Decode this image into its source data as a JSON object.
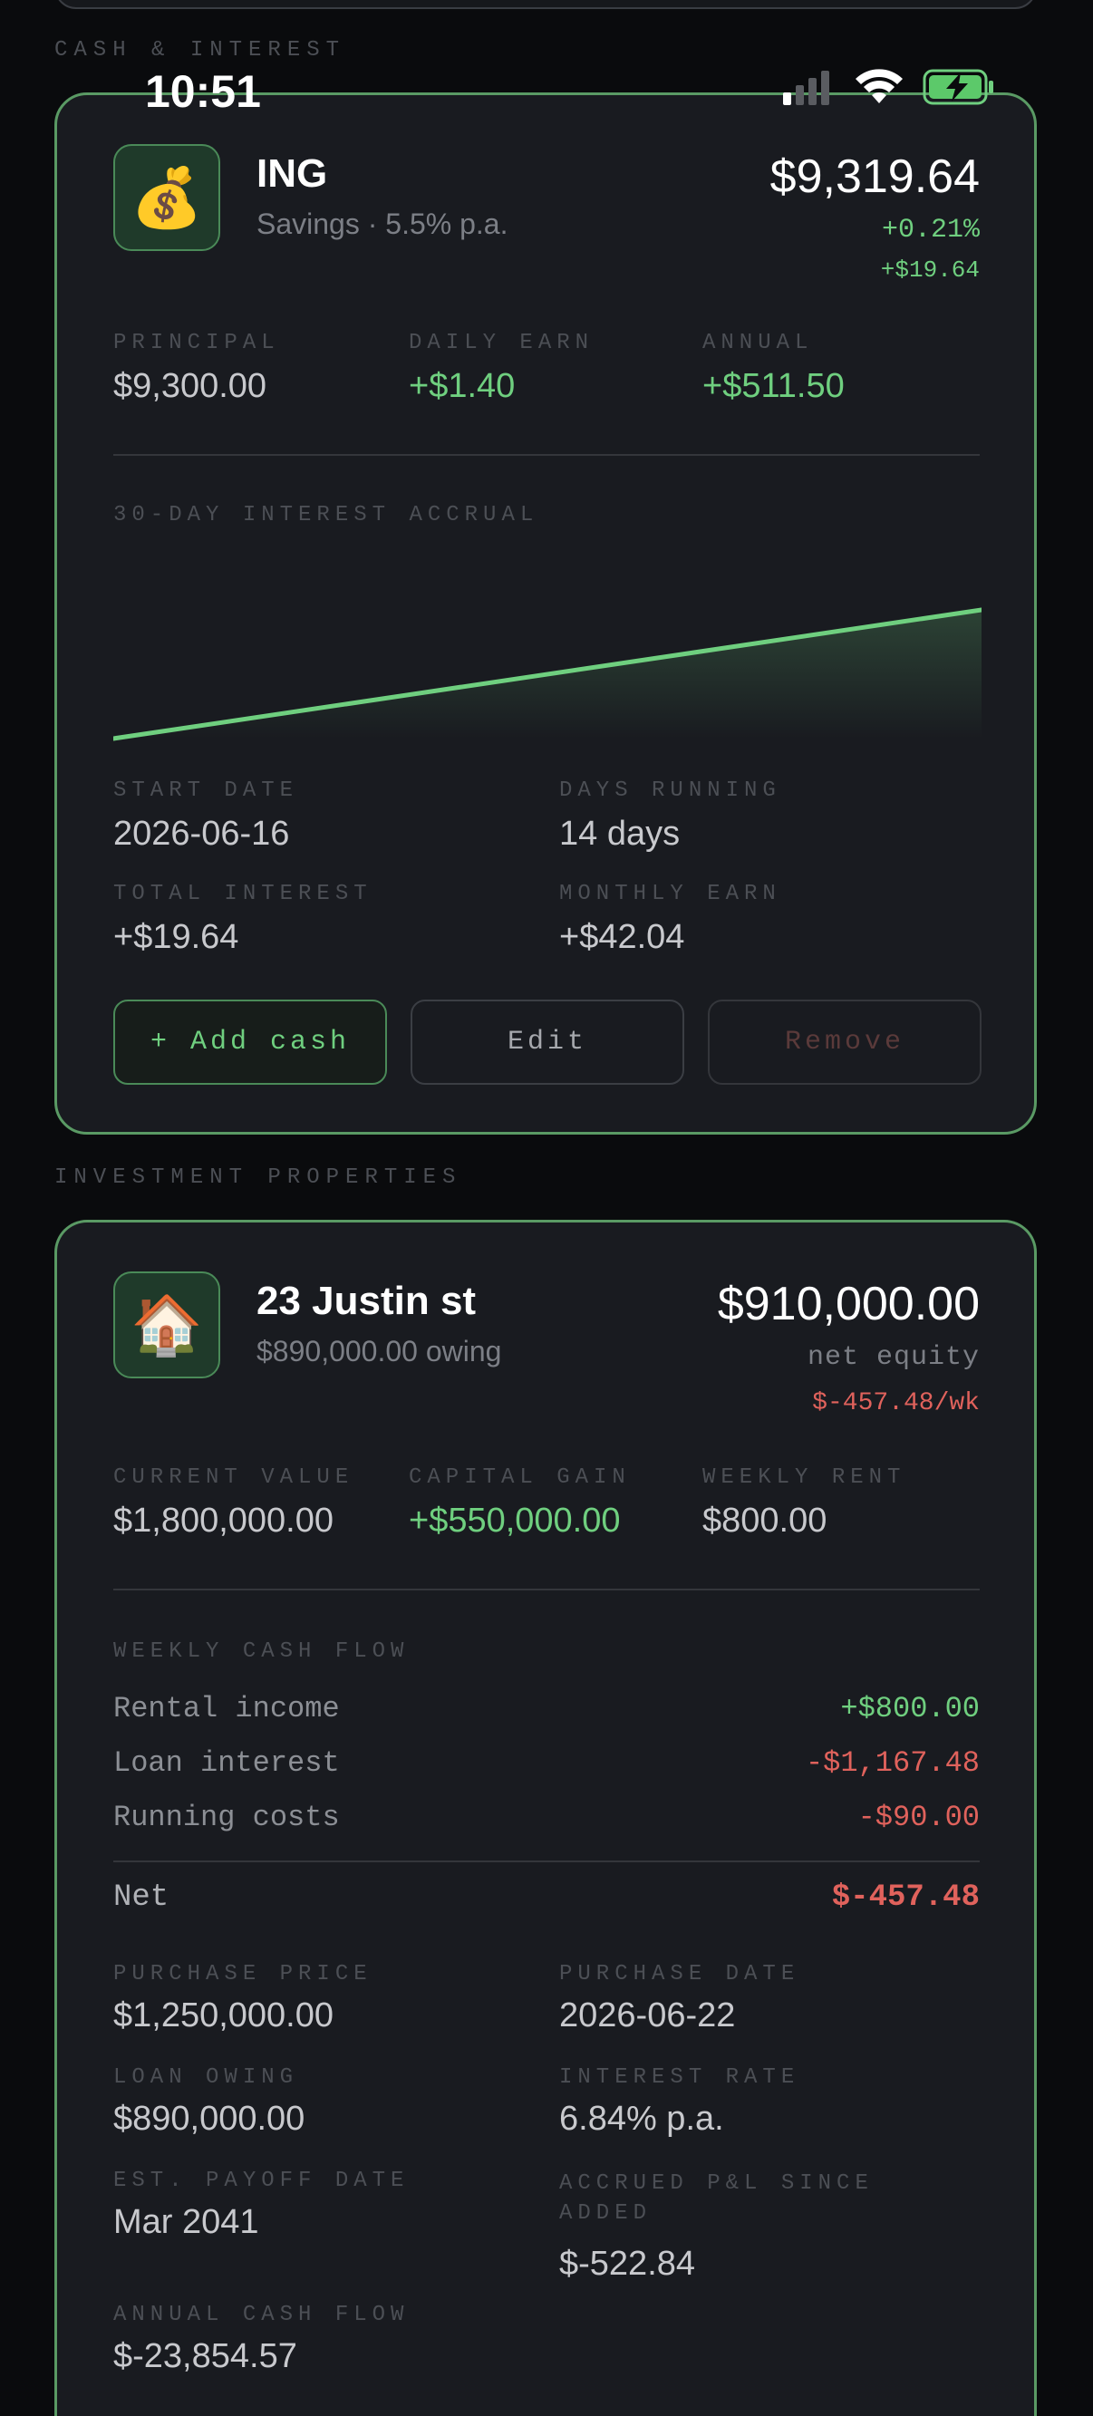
{
  "status_bar": {
    "time": "10:51"
  },
  "sections": {
    "cash": "CASH & INTEREST",
    "properties": "INVESTMENT PROPERTIES"
  },
  "cash_card": {
    "icon": "money-bag-emoji",
    "icon_glyph": "💰",
    "name": "ING",
    "subtitle": "Savings · 5.5% p.a.",
    "value": "$9,319.64",
    "change_pct": "+0.21%",
    "change_abs": "+$19.64",
    "stats": [
      {
        "label": "PRINCIPAL",
        "value": "$9,300.00"
      },
      {
        "label": "DAILY EARN",
        "value": "+$1.40"
      },
      {
        "label": "ANNUAL",
        "value": "+$511.50"
      }
    ],
    "chart_title": "30-DAY INTEREST ACCRUAL",
    "details": [
      {
        "label": "START DATE",
        "value": "2026-06-16"
      },
      {
        "label": "DAYS RUNNING",
        "value": "14 days"
      },
      {
        "label": "TOTAL INTEREST",
        "value": "+$19.64"
      },
      {
        "label": "MONTHLY EARN",
        "value": "+$42.04"
      }
    ],
    "buttons": {
      "add": "+ Add cash",
      "edit": "Edit",
      "remove": "Remove"
    }
  },
  "property_card": {
    "icon": "house-emoji",
    "icon_glyph": "🏠",
    "name": "23 Justin st",
    "subtitle": "$890,000.00 owing",
    "value": "$910,000.00",
    "value_caption": "net equity",
    "weekly_change": "$-457.48/wk",
    "stats": [
      {
        "label": "CURRENT VALUE",
        "value": "$1,800,000.00"
      },
      {
        "label": "CAPITAL GAIN",
        "value": "+$550,000.00"
      },
      {
        "label": "WEEKLY RENT",
        "value": "$800.00"
      }
    ],
    "cash_flow_title": "WEEKLY CASH FLOW",
    "cash_flow": [
      {
        "label": "Rental income",
        "value": "+$800.00"
      },
      {
        "label": "Loan interest",
        "value": "-$1,167.48"
      },
      {
        "label": "Running costs",
        "value": "-$90.00"
      }
    ],
    "net": {
      "label": "Net",
      "value": "$-457.48"
    },
    "details": [
      {
        "label": "PURCHASE PRICE",
        "value": "$1,250,000.00"
      },
      {
        "label": "PURCHASE DATE",
        "value": "2026-06-22"
      },
      {
        "label": "LOAN OWING",
        "value": "$890,000.00"
      },
      {
        "label": "INTEREST RATE",
        "value": "6.84% p.a."
      },
      {
        "label": "EST. PAYOFF DATE",
        "value": "Mar 2041"
      },
      {
        "label": "ACCRUED P&L SINCE ADDED",
        "value": "$-522.84"
      },
      {
        "label": "ANNUAL CASH FLOW",
        "value": "$-23,854.57"
      }
    ]
  },
  "colors": {
    "accent_green": "#6fcf7f",
    "negative_red": "#e0625c",
    "card_border": "#5a9a64",
    "card_bg": "#191b20"
  }
}
